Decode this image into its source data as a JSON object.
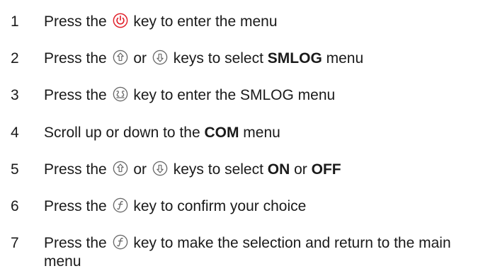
{
  "steps": [
    {
      "number": "1",
      "parts": [
        {
          "t": "text",
          "v": "Press the "
        },
        {
          "t": "icon",
          "icon": "power-key-icon"
        },
        {
          "t": "text",
          "v": " key to enter the menu"
        }
      ]
    },
    {
      "number": "2",
      "parts": [
        {
          "t": "text",
          "v": "Press the "
        },
        {
          "t": "icon",
          "icon": "up-arrow-key-icon"
        },
        {
          "t": "text",
          "v": " or "
        },
        {
          "t": "icon",
          "icon": "down-arrow-key-icon"
        },
        {
          "t": "text",
          "v": " keys to select "
        },
        {
          "t": "bold",
          "v": "SMLOG"
        },
        {
          "t": "text",
          "v": " menu"
        }
      ]
    },
    {
      "number": "3",
      "parts": [
        {
          "t": "text",
          "v": "Press the "
        },
        {
          "t": "icon",
          "icon": "enter-key-icon"
        },
        {
          "t": "text",
          "v": " key to enter the SMLOG menu"
        }
      ]
    },
    {
      "number": "4",
      "parts": [
        {
          "t": "text",
          "v": "Scroll up or down to the "
        },
        {
          "t": "bold",
          "v": "COM"
        },
        {
          "t": "text",
          "v": " menu"
        }
      ]
    },
    {
      "number": "5",
      "parts": [
        {
          "t": "text",
          "v": "Press the "
        },
        {
          "t": "icon",
          "icon": "up-arrow-key-icon"
        },
        {
          "t": "text",
          "v": " or "
        },
        {
          "t": "icon",
          "icon": "down-arrow-key-icon"
        },
        {
          "t": "text",
          "v": " keys to select "
        },
        {
          "t": "bold",
          "v": "ON"
        },
        {
          "t": "text",
          "v": " or "
        },
        {
          "t": "bold",
          "v": "OFF"
        }
      ]
    },
    {
      "number": "6",
      "parts": [
        {
          "t": "text",
          "v": "Press the "
        },
        {
          "t": "icon",
          "icon": "function-key-icon"
        },
        {
          "t": "text",
          "v": " key to confirm your choice"
        }
      ]
    },
    {
      "number": "7",
      "parts": [
        {
          "t": "text",
          "v": "Press the "
        },
        {
          "t": "icon",
          "icon": "function-key-icon"
        },
        {
          "t": "text",
          "v": " key to make the selection and return to the main menu"
        }
      ]
    }
  ],
  "colors": {
    "text": "#1a1a1a",
    "power_icon": "#e0202a",
    "key_icon": "#6a6a6a"
  }
}
